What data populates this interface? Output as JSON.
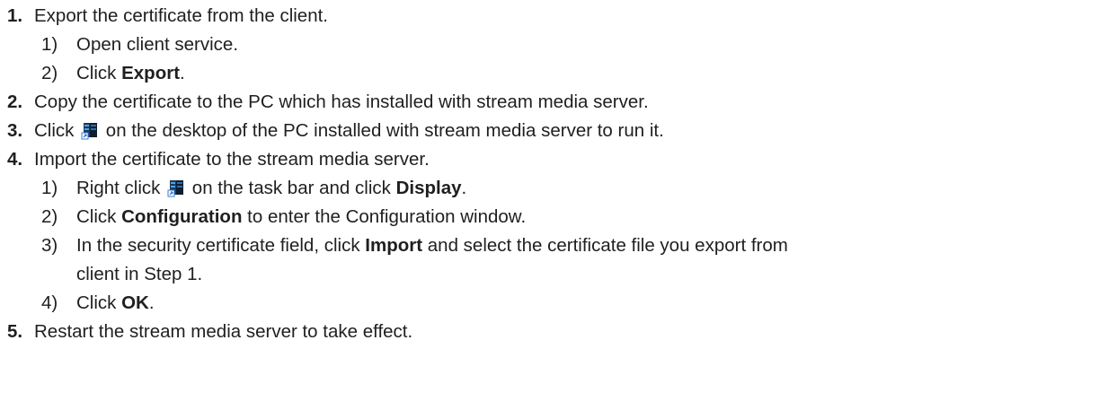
{
  "steps": [
    {
      "num": "1.",
      "text": "Export the certificate from the client."
    },
    {
      "sub": [
        {
          "num": "1)",
          "text": "Open client service."
        },
        {
          "num": "2)",
          "pre": "Click ",
          "bold": "Export",
          "post": "."
        }
      ]
    },
    {
      "num": "2.",
      "text": "Copy the certificate to the PC which has installed with stream media server."
    },
    {
      "num": "3.",
      "pre": "Click ",
      "post": " on the desktop of the PC installed with stream media server to run it."
    },
    {
      "num": "4.",
      "text": "Import the certificate to the stream media server."
    },
    {
      "sub2": [
        {
          "num": "1)",
          "pre": "Right click ",
          "mid": " on the task bar and click ",
          "bold": "Display",
          "post": "."
        },
        {
          "num": "2)",
          "pre": "Click ",
          "bold": "Configuration",
          "post": " to enter the Configuration window."
        },
        {
          "num": "3)",
          "pre": "In the security certificate field, click ",
          "bold": "Import",
          "post": " and select the certificate file you export from",
          "cont": "client in Step 1."
        },
        {
          "num": "4)",
          "pre": "Click ",
          "bold": "OK",
          "post": "."
        }
      ]
    },
    {
      "num": "5.",
      "text": "Restart the stream media server to take effect."
    }
  ],
  "icons": {
    "server_icon": "stream-media-server-icon"
  }
}
